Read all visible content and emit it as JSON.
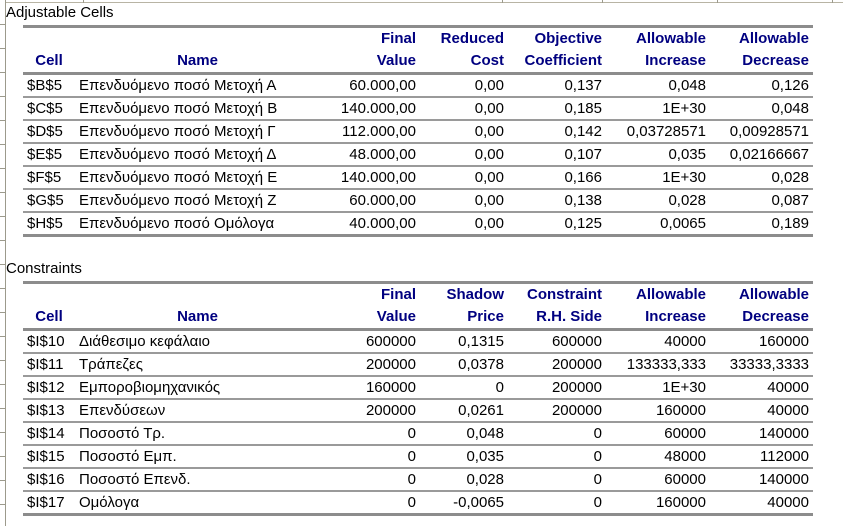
{
  "adjustable": {
    "title": "Adjustable Cells",
    "headers": {
      "cell": "Cell",
      "name": "Name",
      "final_1": "Final",
      "final_2": "Value",
      "reduced_1": "Reduced",
      "reduced_2": "Cost",
      "objective_1": "Objective",
      "objective_2": "Coefficient",
      "inc_1": "Allowable",
      "inc_2": "Increase",
      "dec_1": "Allowable",
      "dec_2": "Decrease"
    },
    "rows": [
      {
        "cell": "$B$5",
        "name": "Επενδυόμενο ποσό Μετοχή Α",
        "final": "60.000,00",
        "reduced": "0,00",
        "objective": "0,137",
        "inc": "0,048",
        "dec": "0,126"
      },
      {
        "cell": "$C$5",
        "name": "Επενδυόμενο ποσό Μετοχή Β",
        "final": "140.000,00",
        "reduced": "0,00",
        "objective": "0,185",
        "inc": "1E+30",
        "dec": "0,048"
      },
      {
        "cell": "$D$5",
        "name": "Επενδυόμενο ποσό Μετοχή Γ",
        "final": "112.000,00",
        "reduced": "0,00",
        "objective": "0,142",
        "inc": "0,03728571",
        "dec": "0,00928571"
      },
      {
        "cell": "$E$5",
        "name": "Επενδυόμενο ποσό Μετοχή Δ",
        "final": "48.000,00",
        "reduced": "0,00",
        "objective": "0,107",
        "inc": "0,035",
        "dec": "0,02166667"
      },
      {
        "cell": "$F$5",
        "name": "Επενδυόμενο ποσό Μετοχή Ε",
        "final": "140.000,00",
        "reduced": "0,00",
        "objective": "0,166",
        "inc": "1E+30",
        "dec": "0,028"
      },
      {
        "cell": "$G$5",
        "name": "Επενδυόμενο ποσό Μετοχή Ζ",
        "final": "60.000,00",
        "reduced": "0,00",
        "objective": "0,138",
        "inc": "0,028",
        "dec": "0,087"
      },
      {
        "cell": "$H$5",
        "name": "Επενδυόμενο ποσό Ομόλογα",
        "final": "40.000,00",
        "reduced": "0,00",
        "objective": "0,125",
        "inc": "0,0065",
        "dec": "0,189"
      }
    ]
  },
  "constraints": {
    "title": "Constraints",
    "headers": {
      "cell": "Cell",
      "name": "Name",
      "final_1": "Final",
      "final_2": "Value",
      "shadow_1": "Shadow",
      "shadow_2": "Price",
      "rhs_1": "Constraint",
      "rhs_2": "R.H. Side",
      "inc_1": "Allowable",
      "inc_2": "Increase",
      "dec_1": "Allowable",
      "dec_2": "Decrease"
    },
    "rows": [
      {
        "cell": "$I$10",
        "name": "Διάθεσιμο κεφάλαιο",
        "final": "600000",
        "shadow": "0,1315",
        "rhs": "600000",
        "inc": "40000",
        "dec": "160000"
      },
      {
        "cell": "$I$11",
        "name": "Τράπεζες",
        "final": "200000",
        "shadow": "0,0378",
        "rhs": "200000",
        "inc": "133333,333",
        "dec": "33333,3333"
      },
      {
        "cell": "$I$12",
        "name": "Εμποροβιομηχανικός",
        "final": "160000",
        "shadow": "0",
        "rhs": "200000",
        "inc": "1E+30",
        "dec": "40000"
      },
      {
        "cell": "$I$13",
        "name": "Επενδύσεων",
        "final": "200000",
        "shadow": "0,0261",
        "rhs": "200000",
        "inc": "160000",
        "dec": "40000"
      },
      {
        "cell": "$I$14",
        "name": "Ποσοστό Τρ.",
        "final": "0",
        "shadow": "0,048",
        "rhs": "0",
        "inc": "60000",
        "dec": "140000"
      },
      {
        "cell": "$I$15",
        "name": "Ποσοστό Εμπ.",
        "final": "0",
        "shadow": "0,035",
        "rhs": "0",
        "inc": "48000",
        "dec": "112000"
      },
      {
        "cell": "$I$16",
        "name": "Ποσοστό Επενδ.",
        "final": "0",
        "shadow": "0,028",
        "rhs": "0",
        "inc": "60000",
        "dec": "140000"
      },
      {
        "cell": "$I$17",
        "name": "Ομόλογα",
        "final": "0",
        "shadow": "-0,0065",
        "rhs": "0",
        "inc": "160000",
        "dec": "40000"
      }
    ]
  }
}
